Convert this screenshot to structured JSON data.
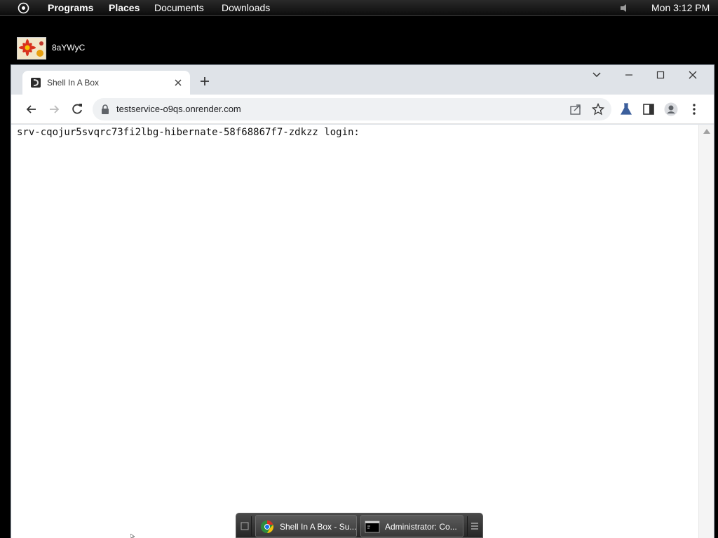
{
  "top_panel": {
    "menus": [
      "Programs",
      "Places",
      "Documents",
      "Downloads"
    ],
    "clock": "Mon 3:12 PM"
  },
  "desktop": {
    "icon_label": "8aYWyC"
  },
  "browser": {
    "tab_title": "Shell In A Box",
    "url": "testservice-o9qs.onrender.com",
    "terminal_text": "srv-cqojur5svqrc73fi2lbg-hibernate-58f68867f7-zdkzz login:"
  },
  "taskbar": {
    "items": [
      {
        "label": "Shell In A Box - Su...",
        "icon": "chrome-icon"
      },
      {
        "label": "Administrator: Co...",
        "icon": "cmd-icon"
      }
    ]
  },
  "colors": {
    "panel_bg": "#111111",
    "window_frame": "#dfe3e8",
    "omnibox_bg": "#eff1f3",
    "taskbar_bg": "#333333"
  }
}
